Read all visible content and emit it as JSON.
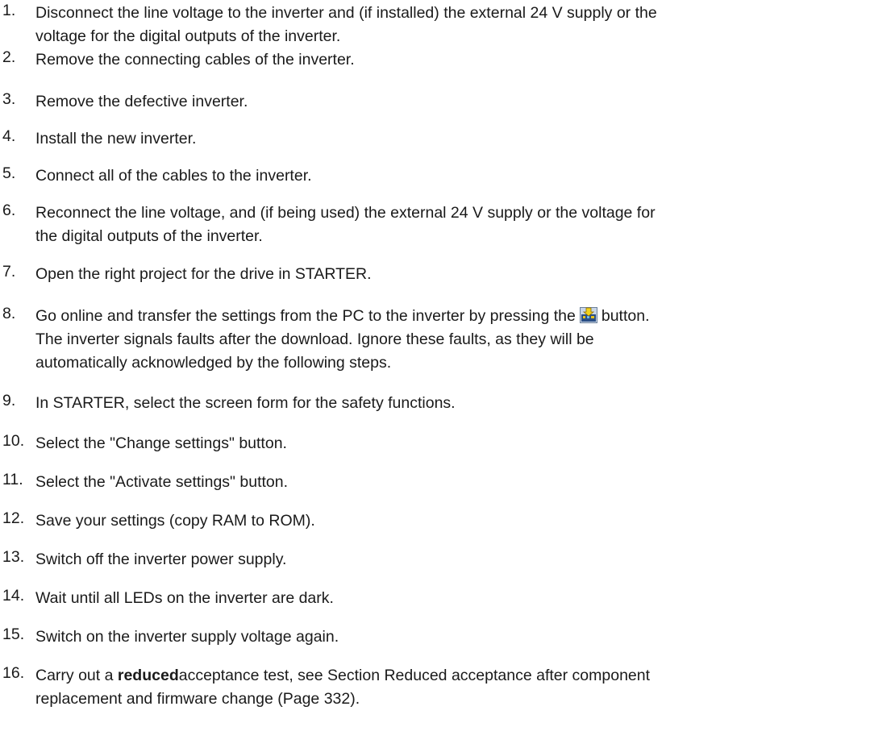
{
  "steps": [
    {
      "num": "1.",
      "lines": [
        "Disconnect the line voltage to the inverter and (if installed) the external 24 V supply or the",
        "voltage for the digital outputs of the inverter."
      ]
    },
    {
      "num": "2.",
      "lines": [
        "Remove the connecting cables of the inverter."
      ]
    },
    {
      "num": "3.",
      "lines": [
        "Remove the defective inverter."
      ]
    },
    {
      "num": "4.",
      "lines": [
        "Install the new inverter."
      ]
    },
    {
      "num": "5.",
      "lines": [
        "Connect all of the cables to the inverter."
      ]
    },
    {
      "num": "6.",
      "lines": [
        "Reconnect the line voltage, and (if being used) the external 24 V supply or the voltage for",
        "the digital outputs of the inverter."
      ]
    },
    {
      "num": "7.",
      "lines": [
        "Open the right project for the drive in STARTER."
      ]
    },
    {
      "num": "8.",
      "line1_before": "Go online and transfer the settings from the PC to the inverter by pressing the",
      "line1_after": "button.",
      "lines_rest": [
        "The inverter signals faults after the download. Ignore these faults, as they will be",
        "automatically acknowledged by the following steps."
      ],
      "icon": "download-to-device-icon"
    },
    {
      "num": "9.",
      "lines": [
        "In STARTER, select the screen form for the safety functions."
      ]
    },
    {
      "num": "10.",
      "lines": [
        "Select the \"Change settings\" button."
      ]
    },
    {
      "num": "11.",
      "lines": [
        "Select the \"Activate settings\" button."
      ]
    },
    {
      "num": "12.",
      "lines": [
        "Save your settings (copy RAM to ROM)."
      ]
    },
    {
      "num": "13.",
      "lines": [
        "Switch off the inverter power supply."
      ]
    },
    {
      "num": "14.",
      "lines": [
        "Wait until all LEDs on the inverter are dark."
      ]
    },
    {
      "num": "15.",
      "lines": [
        "Switch on the inverter supply voltage again."
      ]
    },
    {
      "num": "16.",
      "bold_word": "reduced",
      "line1_after": "acceptance test, see Section Reduced acceptance after component",
      "line1_before": "Carry out a",
      "lines_rest": [
        "replacement and firmware change (Page 332)."
      ]
    }
  ]
}
